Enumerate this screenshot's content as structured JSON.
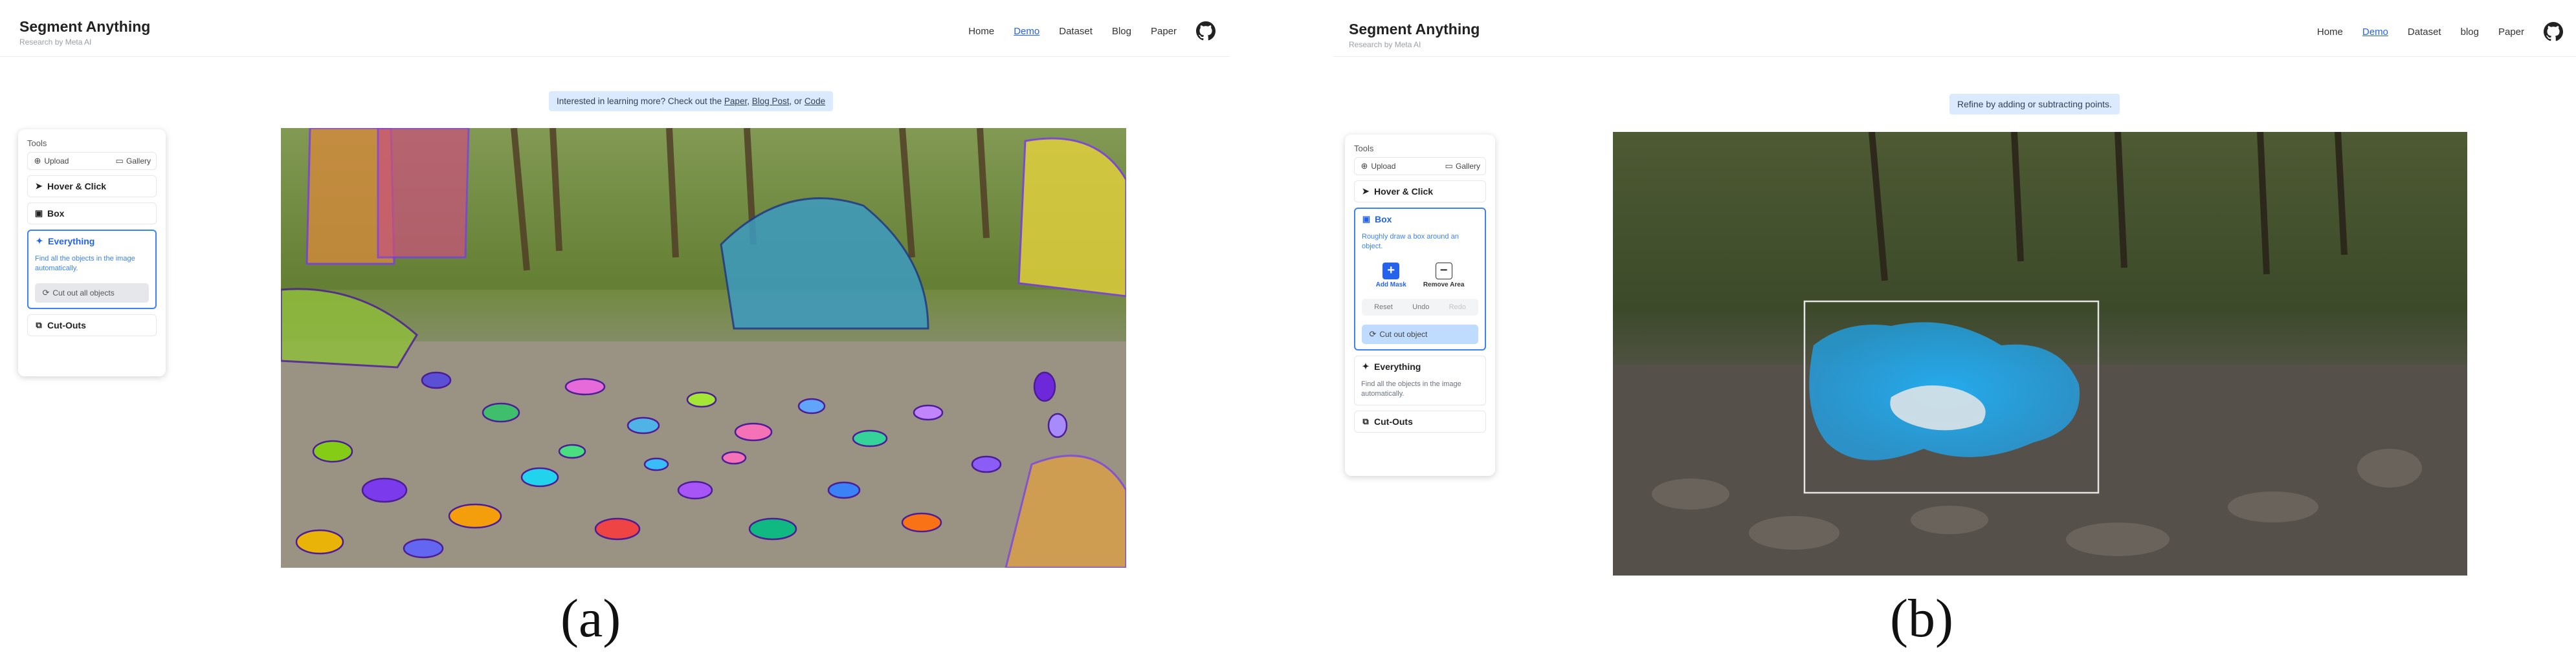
{
  "panel_a": {
    "brand": {
      "title": "Segment Anything",
      "subtitle": "Research by Meta AI"
    },
    "nav": [
      "Home",
      "Demo",
      "Dataset",
      "Blog",
      "Paper"
    ],
    "banner": {
      "text": "Interested in learning more? Check out the",
      "link1": "Paper",
      "sep1": ",",
      "link2": "Blog Post",
      "sep2": ", or",
      "link3": "Code"
    },
    "tools_label": "Tools",
    "upload": "Upload",
    "gallery": "Gallery",
    "hover_click": "Hover & Click",
    "box": "Box",
    "everything": "Everything",
    "everything_desc": "Find all the objects in the image automatically.",
    "cut_all": "Cut out all objects",
    "cutouts": "Cut-Outs"
  },
  "panel_b": {
    "brand": {
      "title": "Segment Anything",
      "subtitle": "Research by Meta AI"
    },
    "nav": [
      "Home",
      "Demo",
      "Dataset",
      "blog",
      "Paper"
    ],
    "banner": "Refine by adding or subtracting points.",
    "tools_label": "Tools",
    "upload": "Upload",
    "gallery": "Gallery",
    "hover_click": "Hover & Click",
    "box": "Box",
    "box_desc": "Roughly draw a box around an object.",
    "add_mask": "Add Mask",
    "remove_area": "Remove Area",
    "reset": "Reset",
    "undo": "Undo",
    "redo": "Redo",
    "cut_object": "Cut out object",
    "everything": "Everything",
    "everything_desc": "Find all the objects in the image automatically.",
    "cutouts": "Cut-Outs"
  },
  "captions": {
    "a": "(a)",
    "b": "(b)"
  },
  "colors": {
    "accent": "#2563eb",
    "banner_bg": "#dbeafe",
    "mask_blue": "#1ea7f0"
  },
  "icons": [
    "github-icon",
    "upload-icon",
    "gallery-icon",
    "cursor-icon",
    "box-icon",
    "sparkle-icon",
    "scissors-icon",
    "plus-icon",
    "minus-icon"
  ]
}
